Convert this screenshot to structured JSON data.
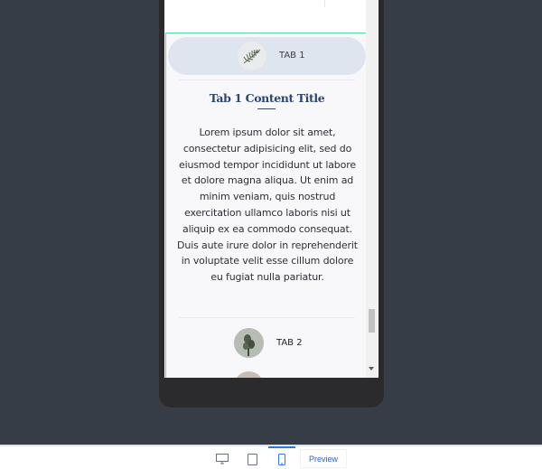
{
  "preview": {
    "tabs": [
      {
        "label": "TAB 1",
        "avatar_icon": "palm-leaf-icon",
        "active": true
      },
      {
        "label": "TAB 2",
        "avatar_icon": "plant-icon",
        "active": false
      },
      {
        "label": "",
        "avatar_icon": "photo-icon",
        "active": false
      }
    ],
    "content": {
      "title": "Tab 1 Content Title",
      "body": "Lorem ipsum dolor sit amet, consectetur adipisicing elit, sed do eiusmod tempor incididunt ut labore et dolore magna aliqua. Ut enim ad minim veniam, quis nostrud exercitation ullamco laboris nisi ut aliquip ex ea commodo consequat. Duis aute irure dolor in reprehenderit in voluptate velit esse cillum dolore eu fugiat nulla pariatur."
    }
  },
  "toolbar": {
    "devices": [
      {
        "name": "desktop",
        "icon": "desktop-icon",
        "active": false
      },
      {
        "name": "tablet",
        "icon": "tablet-icon",
        "active": false
      },
      {
        "name": "mobile",
        "icon": "mobile-icon",
        "active": true
      }
    ],
    "preview_label": "Preview"
  },
  "colors": {
    "canvas_bg": "#363d47",
    "tab_active_bg": "#dfe5ee",
    "selection_outline": "#62d3a6",
    "title_color": "#2b4570",
    "accent": "#2a7be4"
  }
}
